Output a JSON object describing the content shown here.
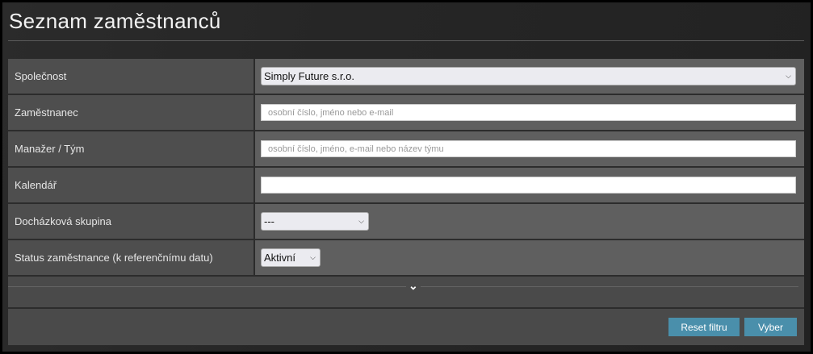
{
  "title": "Seznam zaměstnanců",
  "rows": [
    {
      "label": "Společnost",
      "value": "Simply Future s.r.o."
    },
    {
      "label": "Zaměstnanec",
      "placeholder": "osobní číslo, jméno nebo e-mail"
    },
    {
      "label": "Manažer / Tým",
      "placeholder": "osobní číslo, jméno, e-mail nebo název týmu"
    },
    {
      "label": "Kalendář",
      "value": ""
    },
    {
      "label": "Docházková skupina",
      "value": "---"
    },
    {
      "label": "Status zaměstnance (k referenčnímu datu)",
      "value": "Aktivní"
    }
  ],
  "buttons": {
    "reset": "Reset filtru",
    "select": "Vyber"
  }
}
